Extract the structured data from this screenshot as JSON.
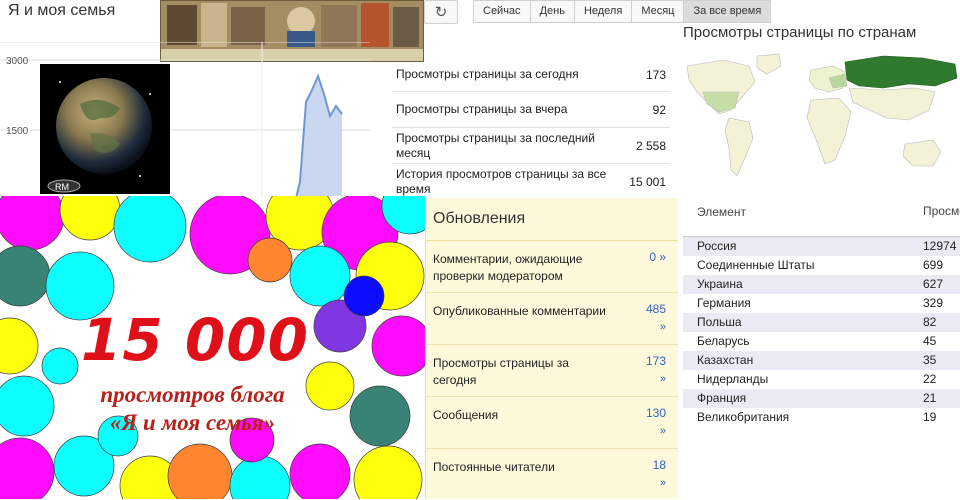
{
  "header": {
    "blog_title": "Я и моя семья",
    "refresh_icon": "↻"
  },
  "range_tabs": [
    "Сейчас",
    "День",
    "Неделя",
    "Месяц",
    "За все время"
  ],
  "chart": {
    "y_ticks": [
      "3000",
      "1500"
    ]
  },
  "stats": [
    {
      "label": "Просмотры страницы за сегодня",
      "value": "173"
    },
    {
      "label": "Просмотры страницы за вчера",
      "value": "92"
    },
    {
      "label": "Просмотры страницы за последний месяц",
      "value": "2 558"
    },
    {
      "label": "История просмотров страницы за все время",
      "value": "15 001"
    }
  ],
  "map": {
    "title": "Просмотры страницы по странам"
  },
  "countries": {
    "col_element": "Элемент",
    "col_views": "Просмотры страницы",
    "rows": [
      {
        "name": "Россия",
        "views": "12974"
      },
      {
        "name": "Соединенные Штаты",
        "views": "699"
      },
      {
        "name": "Украина",
        "views": "627"
      },
      {
        "name": "Германия",
        "views": "329"
      },
      {
        "name": "Польша",
        "views": "82"
      },
      {
        "name": "Беларусь",
        "views": "45"
      },
      {
        "name": "Казахстан",
        "views": "35"
      },
      {
        "name": "Нидерланды",
        "views": "22"
      },
      {
        "name": "Франция",
        "views": "21"
      },
      {
        "name": "Великобритания",
        "views": "19"
      }
    ]
  },
  "updates": {
    "title": "Обновления",
    "items": [
      {
        "label": "Комментарии, ожидающие проверки модератором",
        "value": "0 »",
        "arrow": ""
      },
      {
        "label": "Опубликованные комментарии",
        "value": "485",
        "arrow": "»"
      },
      {
        "label": "Просмотры страницы за сегодня",
        "value": "173",
        "arrow": "»"
      },
      {
        "label": "Сообщения",
        "value": "130",
        "arrow": "»"
      },
      {
        "label": "Постоянные читатели",
        "value": "18",
        "arrow": "»"
      }
    ]
  },
  "banner": {
    "number": "15 000",
    "line1": "просмотров блога",
    "line2": "«Я и моя семья»"
  },
  "globe": {
    "badge": "RM"
  }
}
